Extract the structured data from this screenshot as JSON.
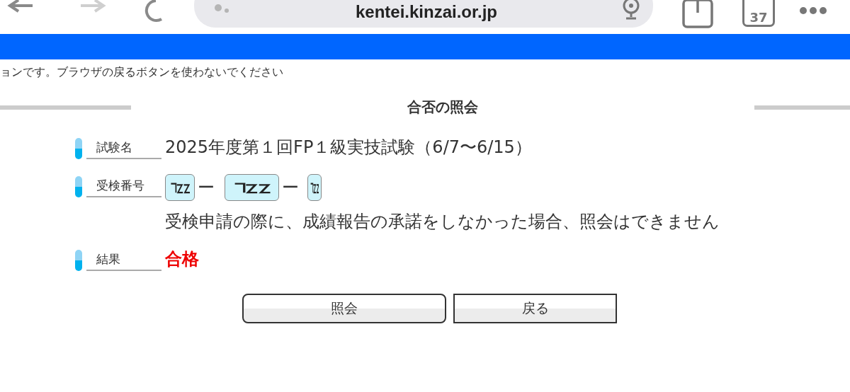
{
  "browser": {
    "url": "kentei.kinzai.or.jp",
    "tab_count": "37"
  },
  "notice": "ョンです。ブラウザの戻るボタンを使わないでください",
  "heading": "合否の照会",
  "rows": [
    {
      "kind": "text",
      "label": "試験名",
      "value": "2025年度第１回FP１級実技試験（6/7〜6/15）"
    },
    {
      "kind": "number",
      "label": "受検番号",
      "fields": [
        {
          "kind": "masked"
        },
        {
          "kind": "masked"
        },
        {
          "kind": "masked"
        }
      ],
      "separators": [
        "ー",
        "ー"
      ],
      "note": "受検申請の際に、成績報告の承諾をしなかった場合、照会はできません"
    },
    {
      "kind": "result",
      "label": "結果",
      "value": "合格"
    }
  ],
  "buttons": [
    {
      "label": "照会",
      "kind": "rounded"
    },
    {
      "label": "戻る",
      "kind": "square"
    }
  ]
}
